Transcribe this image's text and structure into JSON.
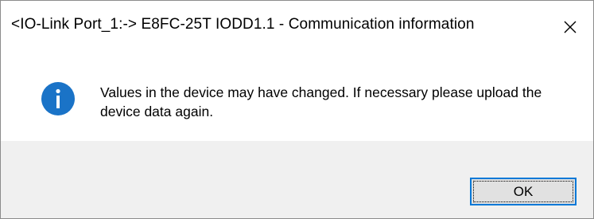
{
  "window": {
    "title": "<IO-Link Port_1:-> E8FC-25T IODD1.1 - Communication information",
    "close_icon": "close-icon"
  },
  "message": {
    "icon": "info-icon",
    "icon_color": "#1a73c7",
    "text": "Values in the device may have changed. If necessary please upload the device data again."
  },
  "buttons": {
    "ok_label": "OK",
    "focus_color": "#0078d7"
  }
}
